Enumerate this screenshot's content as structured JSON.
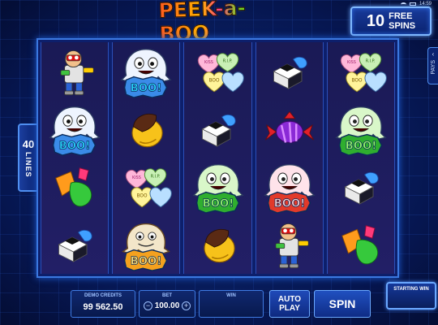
{
  "status": {
    "time": "14:59"
  },
  "logo": {
    "text": "PEEK-a-BOO"
  },
  "free_spins": {
    "count": "10",
    "word1": "FREE",
    "word2": "SPINS"
  },
  "lines": {
    "count": "40",
    "word": "LINES"
  },
  "pays": {
    "label": "PAYS"
  },
  "reels": [
    [
      "robot",
      "ghost",
      "jelly",
      "licorice"
    ],
    [
      "ghost",
      "chocolate",
      "hearts",
      "ghost-brown"
    ],
    [
      "hearts",
      "licorice",
      "ghost-green",
      "chocolate"
    ],
    [
      "licorice",
      "candy-purple",
      "ghost-pink",
      "robot"
    ],
    [
      "hearts",
      "ghost-green",
      "licorice",
      "jelly"
    ]
  ],
  "candy_heart_text": {
    "kiss": "KISS",
    "rip": "R.I.P.",
    "boo": "BOO"
  },
  "boo_text": "BOO!",
  "bottom": {
    "credits_label": "DEMO CREDITS",
    "credits_value": "99 562.50",
    "bet_label": "BET",
    "bet_value": "100.00",
    "bet_minus": "−",
    "bet_plus": "+",
    "win_label": "WIN",
    "win_value": "",
    "autoplay_line1": "AUTO",
    "autoplay_line2": "PLAY",
    "spin_label": "SPIN",
    "starting_win_label": "STARTING WIN"
  },
  "colors": {
    "background": "#081a55",
    "frame": "#3b78e0",
    "reel": "#1a1a55"
  }
}
